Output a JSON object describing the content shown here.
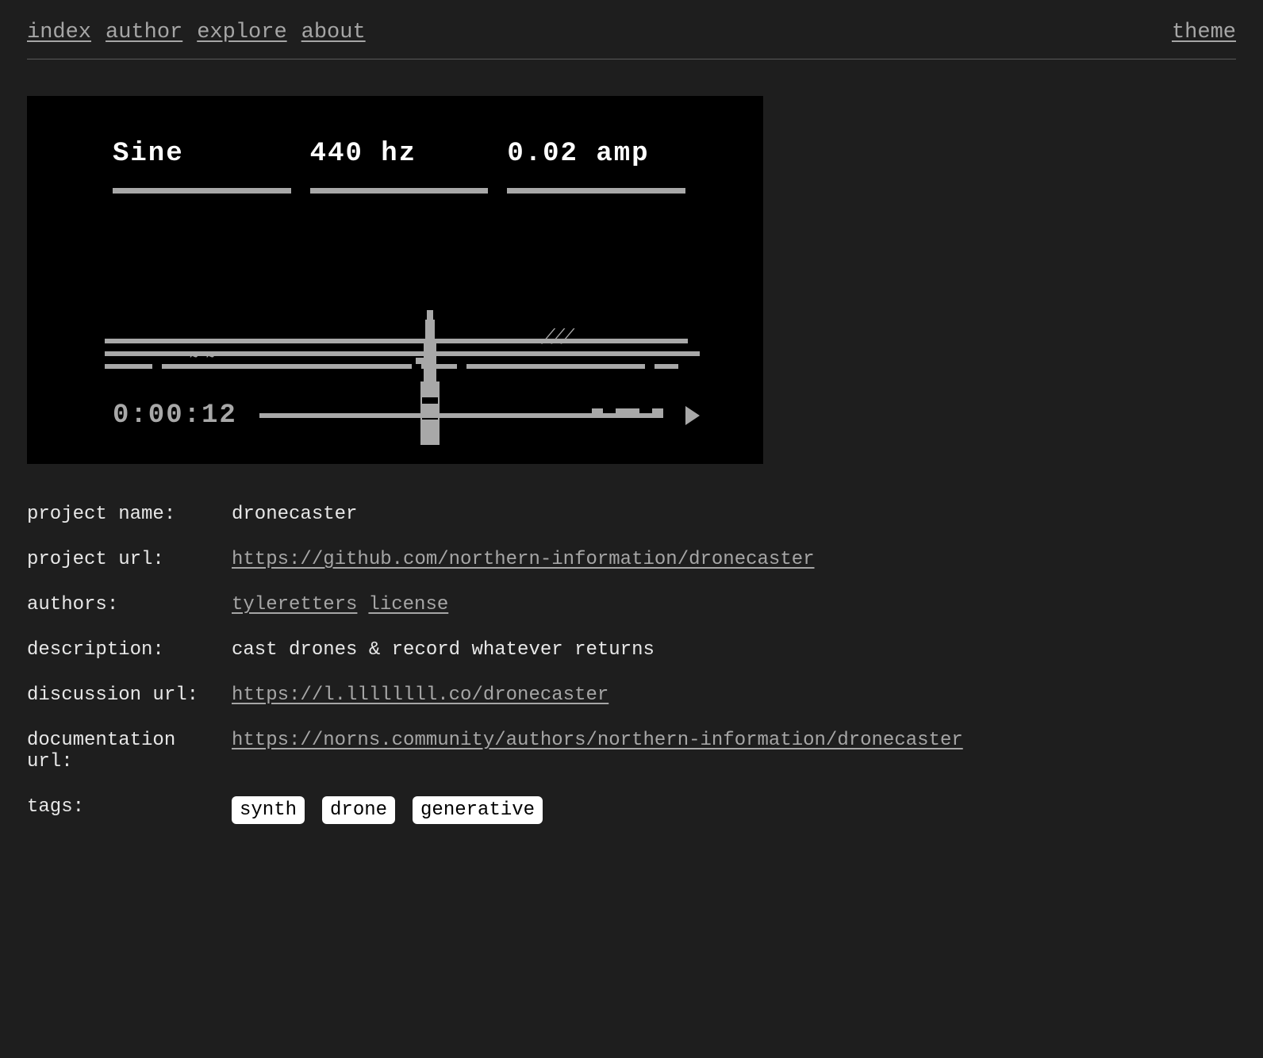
{
  "nav": {
    "links": [
      "index",
      "author",
      "explore",
      "about"
    ],
    "right": "theme"
  },
  "hero": {
    "wave_type": "Sine",
    "frequency": "440 hz",
    "amplitude": "0.02 amp",
    "timer": "0:00:12"
  },
  "meta": {
    "project_name_label": "project name:",
    "project_name": "dronecaster",
    "project_url_label": "project url:",
    "project_url": "https://github.com/northern-information/dronecaster",
    "authors_label": "authors:",
    "authors": [
      "tyleretters",
      "license"
    ],
    "description_label": "description:",
    "description": "cast drones & record whatever returns",
    "discussion_url_label": "discussion url:",
    "discussion_url": "https://l.llllllll.co/dronecaster",
    "documentation_url_label": "documentation url:",
    "documentation_url": "https://norns.community/authors/northern-information/dronecaster",
    "tags_label": "tags:",
    "tags": [
      "synth",
      "drone",
      "generative"
    ]
  }
}
